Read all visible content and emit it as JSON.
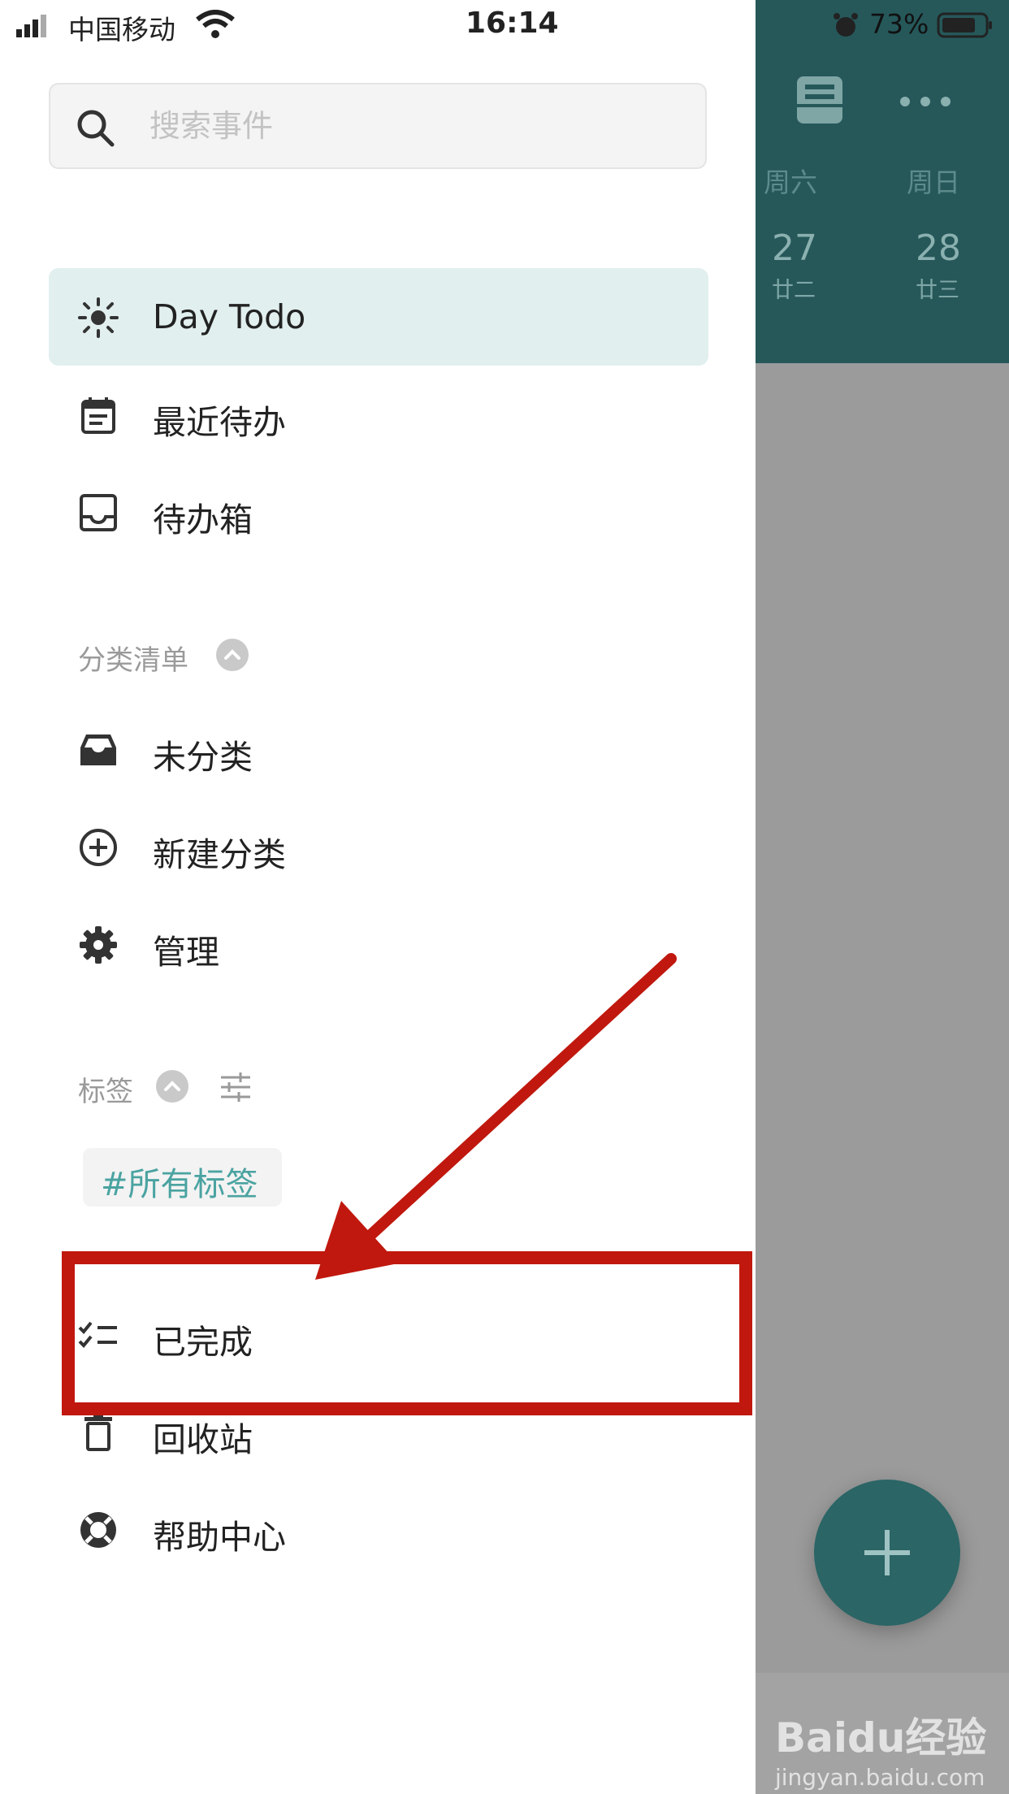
{
  "status_bar": {
    "carrier": "中国移动",
    "time": "16:14",
    "battery": "73%"
  },
  "search": {
    "placeholder": "搜索事件"
  },
  "nav": {
    "day_todo": "Day Todo",
    "recent": "最近待办",
    "inbox": "待办箱"
  },
  "categories": {
    "header": "分类清单",
    "uncategorized": "未分类",
    "new_category": "新建分类",
    "manage": "管理"
  },
  "tags": {
    "header": "标签",
    "all_tags": "#所有标签"
  },
  "footer_nav": {
    "completed": "已完成",
    "trash": "回收站",
    "help": "帮助中心"
  },
  "calendar": {
    "days": [
      {
        "name": "周六",
        "num": "27",
        "lunar": "廿二"
      },
      {
        "name": "周日",
        "num": "28",
        "lunar": "廿三"
      }
    ]
  },
  "watermark": {
    "logo": "Baidu经验",
    "url": "jingyan.baidu.com"
  },
  "colors": {
    "header_teal": "#26585a",
    "fab_teal": "#2b6566",
    "active_bg": "#e1efee",
    "tag_text": "#4aa3a1",
    "annotation_red": "#c0180e"
  },
  "icons": [
    "signal-icon",
    "wifi-icon",
    "alarm-icon",
    "battery-icon",
    "search-icon",
    "sun-icon",
    "calendar-icon",
    "inbox-tray-icon",
    "archive-tray-icon",
    "plus-circle-icon",
    "gear-icon",
    "chevron-up-icon",
    "sliders-icon",
    "checklist-icon",
    "trash-icon",
    "lifebuoy-icon",
    "drawer-icon",
    "more-icon",
    "plus-icon"
  ]
}
